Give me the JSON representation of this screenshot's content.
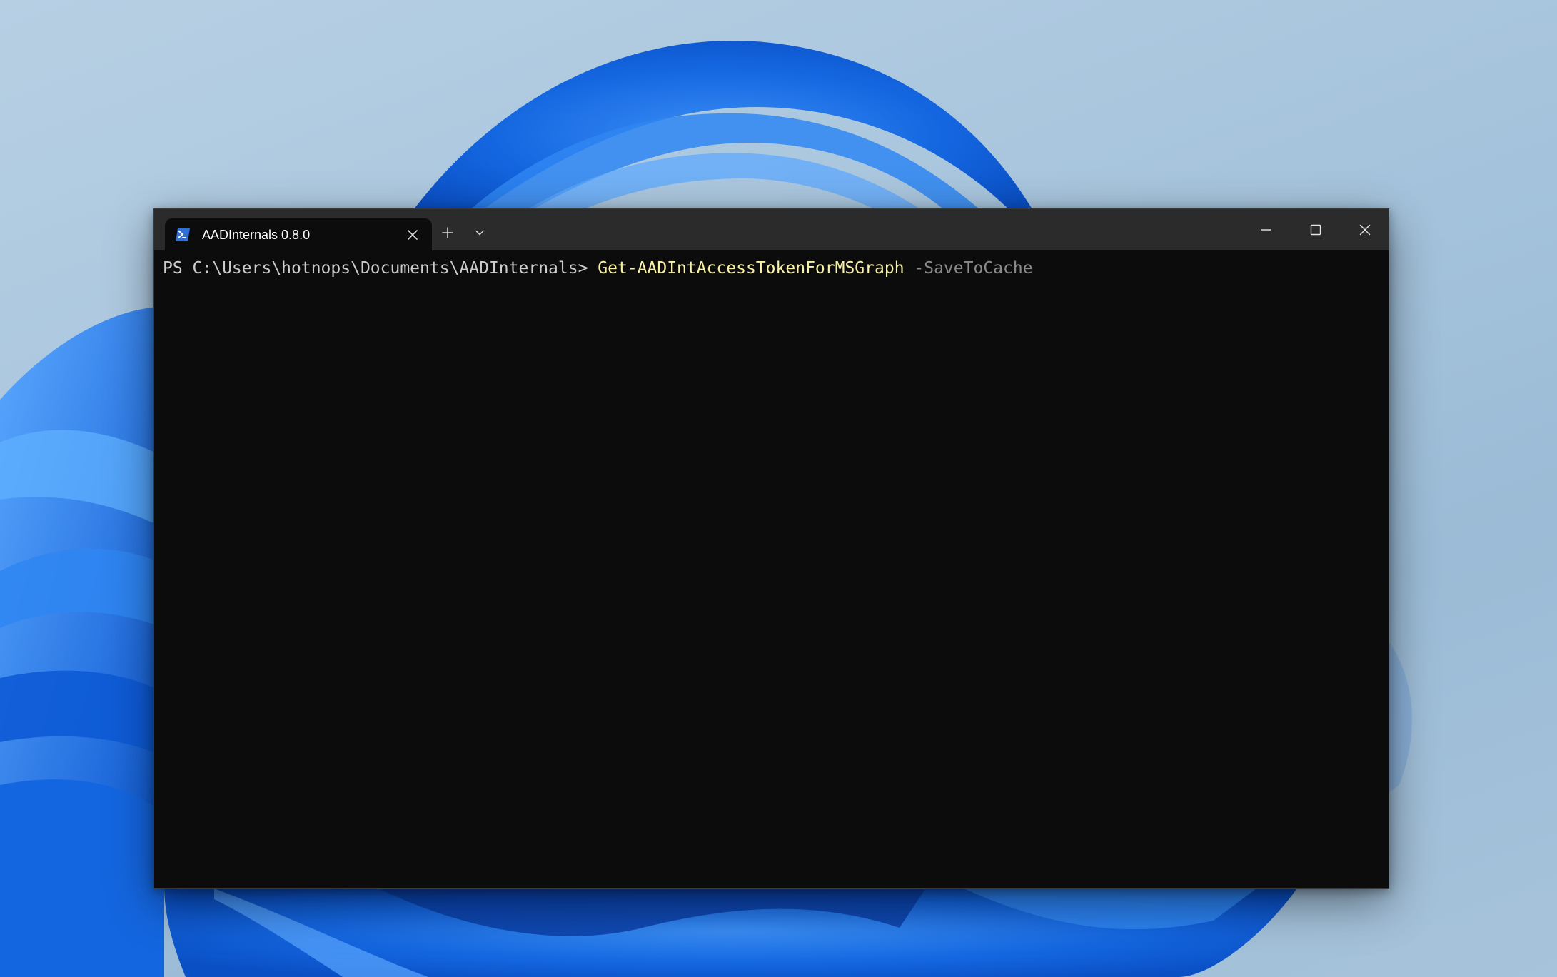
{
  "window": {
    "tab_title": "AADInternals 0.8.0",
    "tab_icon": "powershell-icon"
  },
  "terminal": {
    "prompt": "PS C:\\Users\\hotnops\\Documents\\AADInternals> ",
    "command": "Get-AADIntAccessTokenForMSGraph",
    "parameter": " -SaveToCache"
  },
  "colors": {
    "terminal_bg": "#0c0c0c",
    "titlebar_bg": "#2b2b2b",
    "prompt_text": "#cccccc",
    "command_text": "#f9f1a5",
    "parameter_text": "#8a8a8a",
    "wallpaper_accent": "#1a73e8"
  }
}
